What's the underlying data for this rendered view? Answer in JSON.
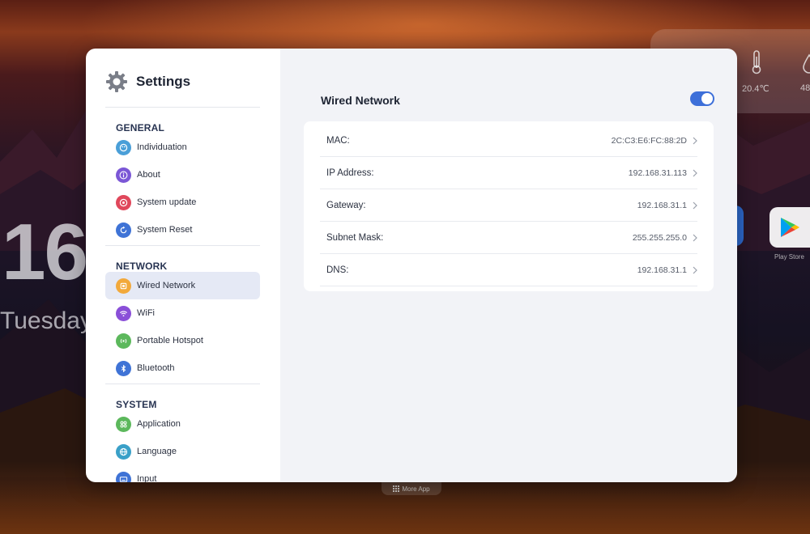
{
  "desktop": {
    "clock_digits": "16",
    "day": "Tuesday",
    "weather": {
      "temperature": "20.4℃",
      "humidity_partial": "48"
    },
    "dock": {
      "play_store_label": "Play Store",
      "more_app_label": "More App"
    }
  },
  "settings": {
    "title": "Settings",
    "sections": [
      {
        "title": "GENERAL",
        "items": [
          {
            "label": "Individuation",
            "icon": "palette-icon",
            "color": "#4a9fd8"
          },
          {
            "label": "About",
            "icon": "info-icon",
            "color": "#7b57d6"
          },
          {
            "label": "System update",
            "icon": "update-icon",
            "color": "#e0475b"
          },
          {
            "label": "System Reset",
            "icon": "reset-icon",
            "color": "#3f73d6"
          }
        ]
      },
      {
        "title": "NETWORK",
        "items": [
          {
            "label": "Wired Network",
            "icon": "ethernet-icon",
            "color": "#f2a93b",
            "active": true
          },
          {
            "label": "WiFi",
            "icon": "wifi-icon",
            "color": "#8a4fd8"
          },
          {
            "label": "Portable Hotspot",
            "icon": "hotspot-icon",
            "color": "#5cb85c"
          },
          {
            "label": "Bluetooth",
            "icon": "bluetooth-icon",
            "color": "#3f73d6"
          }
        ]
      },
      {
        "title": "SYSTEM",
        "items": [
          {
            "label": "Application",
            "icon": "apps-icon",
            "color": "#5cb85c"
          },
          {
            "label": "Language",
            "icon": "globe-icon",
            "color": "#3aa0c8"
          },
          {
            "label": "Input",
            "icon": "keyboard-icon",
            "color": "#3f73d6"
          }
        ]
      }
    ],
    "panel": {
      "title": "Wired Network",
      "enabled": true,
      "rows": [
        {
          "label": "MAC:",
          "value": "2C:C3:E6:FC:88:2D"
        },
        {
          "label": "IP Address:",
          "value": "192.168.31.113"
        },
        {
          "label": "Gateway:",
          "value": "192.168.31.1"
        },
        {
          "label": "Subnet Mask:",
          "value": "255.255.255.0"
        },
        {
          "label": "DNS:",
          "value": "192.168.31.1"
        }
      ]
    },
    "accent_color": "#3d6fd9"
  }
}
